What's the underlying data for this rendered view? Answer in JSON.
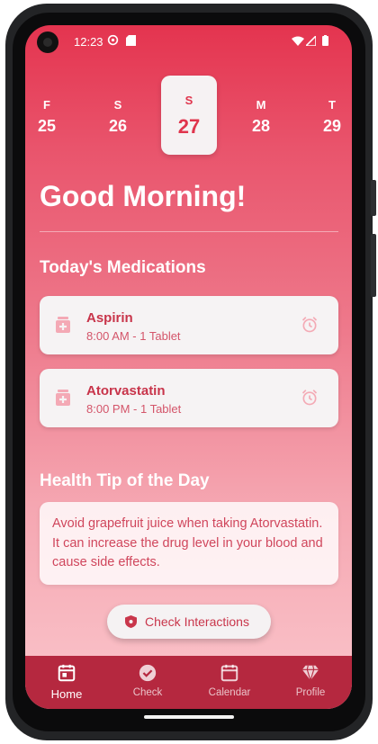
{
  "status_bar": {
    "time": "12:23"
  },
  "date_strip": {
    "days": [
      {
        "name": "F",
        "num": "25"
      },
      {
        "name": "S",
        "num": "26"
      },
      {
        "name": "S",
        "num": "27"
      },
      {
        "name": "M",
        "num": "28"
      },
      {
        "name": "T",
        "num": "29"
      }
    ]
  },
  "greeting": "Good Morning!",
  "medications": {
    "title": "Today's Medications",
    "items": [
      {
        "name": "Aspirin",
        "schedule": "8:00 AM - 1 Tablet"
      },
      {
        "name": "Atorvastatin",
        "schedule": "8:00 PM - 1 Tablet"
      }
    ]
  },
  "health_tip": {
    "title": "Health Tip of the Day",
    "text": "Avoid grapefruit juice when taking Atorvastatin. It can increase the drug level in your blood and cause side effects."
  },
  "check_button": {
    "label": "Check Interactions"
  },
  "bottom_nav": {
    "items": [
      {
        "label": "Home",
        "icon": "calendar-day-icon"
      },
      {
        "label": "Check",
        "icon": "check-circle-icon"
      },
      {
        "label": "Calendar",
        "icon": "calendar-icon"
      },
      {
        "label": "Profile",
        "icon": "diamond-icon"
      }
    ]
  },
  "colors": {
    "accent": "#e0354d",
    "nav_background": "#b5283f",
    "card_background": "#f6f3f4"
  }
}
